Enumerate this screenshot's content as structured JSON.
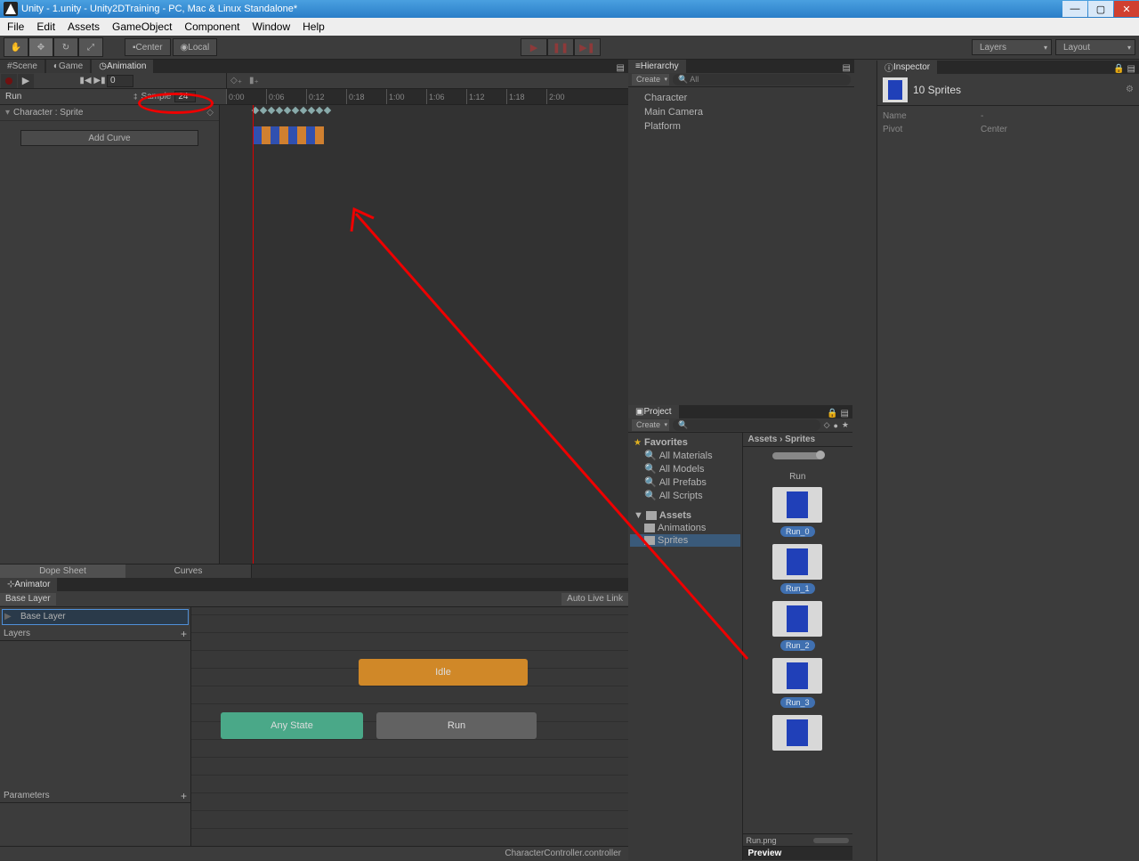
{
  "titlebar": "Unity - 1.unity - Unity2DTraining - PC, Mac & Linux Standalone*",
  "menubar": [
    "File",
    "Edit",
    "Assets",
    "GameObject",
    "Component",
    "Window",
    "Help"
  ],
  "toolbar": {
    "center": "Center",
    "local": "Local",
    "layers": "Layers",
    "layout": "Layout"
  },
  "tabs_left": {
    "scene": "Scene",
    "game": "Game",
    "animation": "Animation"
  },
  "animation": {
    "frame": "0",
    "clip": "Run",
    "sample_label": "Sample",
    "sample_val": "24",
    "ruler": [
      "0:00",
      "0:06",
      "0:12",
      "0:18",
      "1:00",
      "1:06",
      "1:12",
      "1:18",
      "2:00"
    ],
    "prop": "Character : Sprite",
    "add_curve": "Add Curve",
    "dope": "Dope Sheet",
    "curves": "Curves"
  },
  "animator": {
    "tab": "Animator",
    "breadcrumb": "Base Layer",
    "auto_live": "Auto Live Link",
    "layer": "Base Layer",
    "layers": "Layers",
    "params": "Parameters",
    "nodes": {
      "idle": "Idle",
      "any": "Any State",
      "run": "Run"
    },
    "status": "CharacterController.controller"
  },
  "hierarchy": {
    "tab": "Hierarchy",
    "create": "Create",
    "search": "All",
    "items": [
      "Character",
      "Main Camera",
      "Platform"
    ]
  },
  "project": {
    "tab": "Project",
    "create": "Create",
    "favorites": "Favorites",
    "favs": [
      "All Materials",
      "All Models",
      "All Prefabs",
      "All Scripts"
    ],
    "assets": "Assets",
    "folders": [
      "Animations",
      "Sprites"
    ],
    "path": "Assets › Sprites",
    "run_group": "Run",
    "sprites": [
      "Run_0",
      "Run_1",
      "Run_2",
      "Run_3"
    ],
    "footer": "Run.png",
    "preview": "Preview"
  },
  "inspector": {
    "tab": "Inspector",
    "title": "10 Sprites",
    "name_k": "Name",
    "name_v": "-",
    "pivot_k": "Pivot",
    "pivot_v": "Center"
  }
}
